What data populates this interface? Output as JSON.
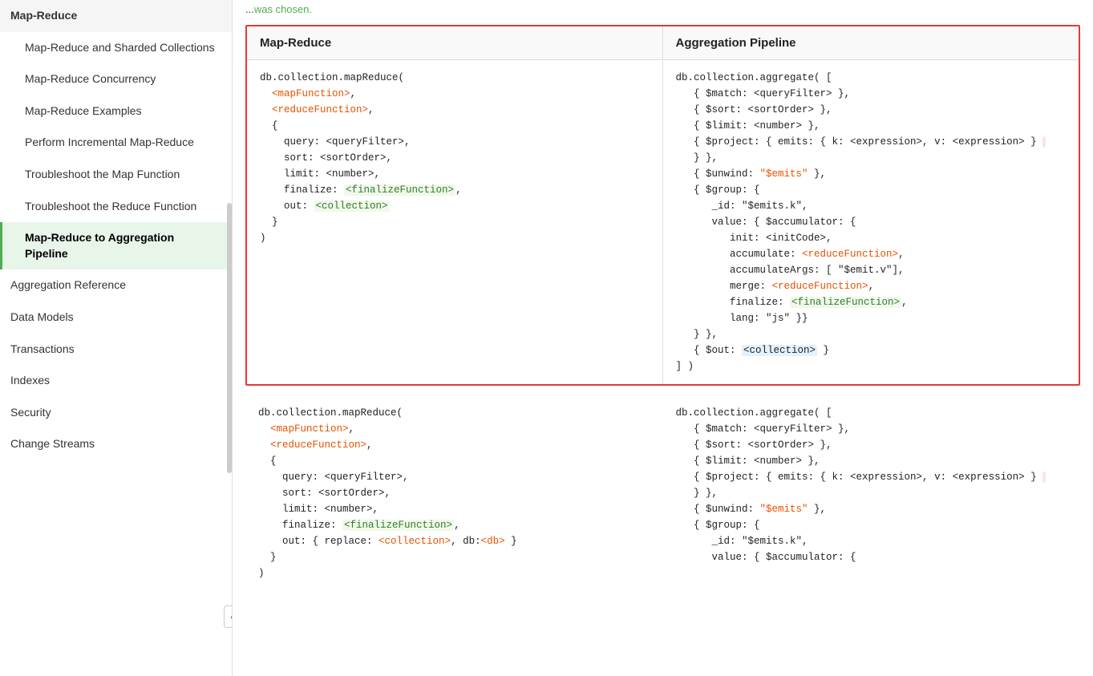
{
  "sidebar": {
    "items": [
      {
        "id": "map-reduce",
        "label": "Map-Reduce",
        "active": false,
        "indent": false
      },
      {
        "id": "map-reduce-sharded",
        "label": "Map-Reduce and Sharded Collections",
        "active": false,
        "indent": true
      },
      {
        "id": "map-reduce-concurrency",
        "label": "Map-Reduce Concurrency",
        "active": false,
        "indent": true
      },
      {
        "id": "map-reduce-examples",
        "label": "Map-Reduce Examples",
        "active": false,
        "indent": true
      },
      {
        "id": "incremental-map-reduce",
        "label": "Perform Incremental Map-Reduce",
        "active": false,
        "indent": true
      },
      {
        "id": "troubleshoot-map",
        "label": "Troubleshoot the Map Function",
        "active": false,
        "indent": true
      },
      {
        "id": "troubleshoot-reduce",
        "label": "Troubleshoot the Reduce Function",
        "active": false,
        "indent": true
      },
      {
        "id": "map-reduce-aggregation",
        "label": "Map-Reduce to Aggregation Pipeline",
        "active": true,
        "indent": true
      },
      {
        "id": "aggregation-reference",
        "label": "Aggregation Reference",
        "active": false,
        "indent": false
      },
      {
        "id": "data-models",
        "label": "Data Models",
        "active": false,
        "indent": false
      },
      {
        "id": "transactions",
        "label": "Transactions",
        "active": false,
        "indent": false
      },
      {
        "id": "indexes",
        "label": "Indexes",
        "active": false,
        "indent": false
      },
      {
        "id": "security",
        "label": "Security",
        "active": false,
        "indent": false
      },
      {
        "id": "change-streams",
        "label": "Change Streams",
        "active": false,
        "indent": false
      }
    ],
    "collapse_icon": "❮"
  },
  "main": {
    "top_text": "...was chosen.",
    "table1": {
      "col1_header": "Map-Reduce",
      "col2_header": "Aggregation Pipeline",
      "col1_code": "db.collection.mapReduce(\n  <mapFunction>,\n  <reduceFunction>,\n  {\n    query: <queryFilter>,\n    sort: <sortOrder>,\n    limit: <number>,\n    finalize: <finalizeFunction>,\n    out: <collection>\n  }\n)",
      "col2_code": "db.collection.aggregate( [\n   { $match: <queryFilter> },\n   { $sort: <sortOrder> },\n   { $limit: <number> },\n   { $project: { emits: { k: <expression>, v: <expression> }\n   } },\n   { $unwind: \"$emits\" },\n   { $group: {\n      _id: \"$emits.k\",\n      value: { $accumulator: {\n         init: <initCode>,\n         accumulate: <reduceFunction>,\n         accumulateArgs: [ \"$emit.v\"],\n         merge: <reduceFunction>,\n         finalize: <finalizeFunction>,\n         lang: \"js\" }}\n   } },\n   { $out: <collection> }\n] )"
    },
    "table2": {
      "col1_code": "db.collection.mapReduce(\n  <mapFunction>,\n  <reduceFunction>,\n  {\n    query: <queryFilter>,\n    sort: <sortOrder>,\n    limit: <number>,\n    finalize: <finalizeFunction>,\n    out: { replace: <collection>, db:<db> }\n  }\n)",
      "col2_code": "db.collection.aggregate( [\n   { $match: <queryFilter> },\n   { $sort: <sortOrder> },\n   { $limit: <number> },\n   { $project: { emits: { k: <expression>, v: <expression> }\n   } },\n   { $unwind: \"$emits\" },\n   { $group: {\n      _id: \"$emits.k\",\n      value: { $accumulator: {"
    }
  }
}
